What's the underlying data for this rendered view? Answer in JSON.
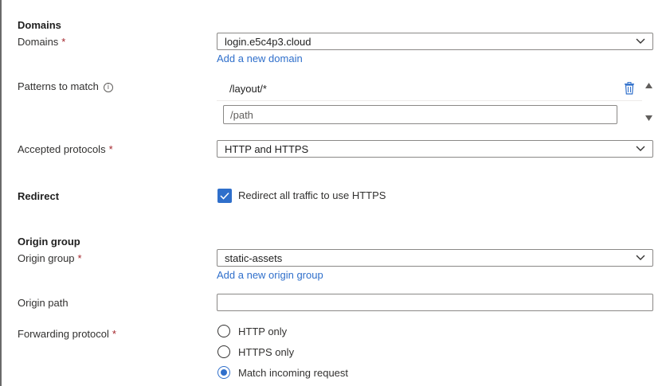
{
  "domains_section": {
    "title": "Domains",
    "label": "Domains",
    "required_mark": "*",
    "selected_value": "login.e5c4p3.cloud",
    "add_link": "Add a new domain"
  },
  "patterns": {
    "label": "Patterns to match",
    "info_glyph": "i",
    "existing_pattern": "/layout/*",
    "new_pattern_placeholder": "/path"
  },
  "protocols": {
    "label": "Accepted protocols",
    "required_mark": "*",
    "selected_value": "HTTP and HTTPS"
  },
  "redirect": {
    "label": "Redirect",
    "checkbox_label": "Redirect all traffic to use HTTPS",
    "checked": true
  },
  "origin_section": {
    "title": "Origin group",
    "label": "Origin group",
    "required_mark": "*",
    "selected_value": "static-assets",
    "add_link": "Add a new origin group"
  },
  "origin_path": {
    "label": "Origin path",
    "value": ""
  },
  "forwarding": {
    "label": "Forwarding protocol",
    "required_mark": "*",
    "options": [
      "HTTP only",
      "HTTPS only",
      "Match incoming request"
    ],
    "selected_index": 2
  },
  "colors": {
    "accent": "#2f6fcb",
    "required": "#a4262c",
    "border": "#8a8886"
  }
}
